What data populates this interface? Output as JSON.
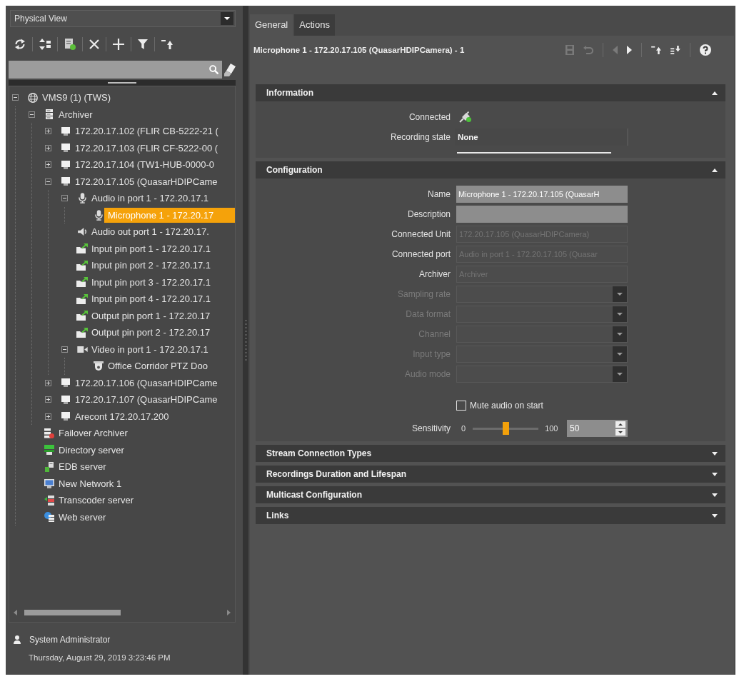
{
  "left_panel": {
    "view": "Physical View",
    "toolbar": [
      [
        {
          "kind": "refresh"
        }
      ],
      [
        {
          "kind": "sort"
        }
      ],
      [
        {
          "kind": "add-entity"
        }
      ],
      [
        {
          "kind": "delete"
        }
      ],
      [
        {
          "kind": "add"
        }
      ],
      [
        {
          "kind": "filter"
        }
      ],
      [
        {
          "kind": "move-up"
        }
      ]
    ],
    "tree": [
      {
        "label": "VMS9 (1) (TWS)",
        "kind": "system",
        "expanded": true,
        "selected": false,
        "children": [
          {
            "label": "Archiver",
            "kind": "archiver",
            "expanded": true,
            "selected": false,
            "children": [
              {
                "label": "172.20.17.102 (FLIR CB-5222-21 (",
                "kind": "unit",
                "expanded": false,
                "selected": false
              },
              {
                "label": "172.20.17.103 (FLIR CF-5222-00 (",
                "kind": "unit",
                "expanded": false,
                "selected": false
              },
              {
                "label": "172.20.17.104 (TW1-HUB-0000-0",
                "kind": "unit",
                "expanded": false,
                "selected": false
              },
              {
                "label": "172.20.17.105 (QuasarHDIPCame",
                "kind": "unit",
                "expanded": true,
                "selected": false,
                "children": [
                  {
                    "label": "Audio in port 1 - 172.20.17.1",
                    "kind": "audio-in",
                    "expanded": true,
                    "selected": false,
                    "children": [
                      {
                        "label": "Microphone 1 - 172.20.17",
                        "kind": "microphone",
                        "selected": true
                      }
                    ]
                  },
                  {
                    "label": "Audio out port 1 - 172.20.17.",
                    "kind": "audio-out",
                    "selected": false
                  },
                  {
                    "label": "Input pin port 1 - 172.20.17.1",
                    "kind": "input-pin",
                    "selected": false
                  },
                  {
                    "label": "Input pin port 2 - 172.20.17.1",
                    "kind": "input-pin",
                    "selected": false
                  },
                  {
                    "label": "Input pin port 3 - 172.20.17.1",
                    "kind": "input-pin",
                    "selected": false
                  },
                  {
                    "label": "Input pin port 4 - 172.20.17.1",
                    "kind": "input-pin",
                    "selected": false
                  },
                  {
                    "label": "Output pin port 1 - 172.20.17",
                    "kind": "output-pin",
                    "selected": false
                  },
                  {
                    "label": "Output pin port 2 - 172.20.17",
                    "kind": "output-pin",
                    "selected": false
                  },
                  {
                    "label": "Video in port 1 - 172.20.17.1",
                    "kind": "video-in",
                    "expanded": true,
                    "selected": false,
                    "children": [
                      {
                        "label": "Office Corridor PTZ Doo",
                        "kind": "camera",
                        "selected": false
                      }
                    ]
                  }
                ]
              },
              {
                "label": "172.20.17.106 (QuasarHDIPCame",
                "kind": "unit",
                "expanded": false,
                "selected": false
              },
              {
                "label": "172.20.17.107 (QuasarHDIPCame",
                "kind": "unit",
                "expanded": false,
                "selected": false
              },
              {
                "label": "Arecont 172.20.17.200",
                "kind": "unit",
                "expanded": false,
                "selected": false
              }
            ]
          },
          {
            "label": "Failover Archiver",
            "kind": "failover-archiver",
            "selected": false
          },
          {
            "label": "Directory server",
            "kind": "directory",
            "selected": false
          },
          {
            "label": "EDB server",
            "kind": "database",
            "selected": false
          },
          {
            "label": "New Network 1",
            "kind": "network",
            "selected": false
          },
          {
            "label": "Transcoder server",
            "kind": "transcoder",
            "selected": false
          },
          {
            "label": "Web server",
            "kind": "web-server",
            "selected": false
          }
        ]
      }
    ],
    "user": "System Administrator",
    "datetime": "Thursday, August 29, 2019 3:23:46 PM"
  },
  "right_panel": {
    "tabs": [
      {
        "label": "General",
        "selected": true
      },
      {
        "label": "Actions",
        "selected": false
      }
    ],
    "title": "Microphone 1 - 172.20.17.105 (QuasarHDIPCamera) - 1",
    "toolbar": [
      [
        {
          "kind": "save",
          "disabled": true
        },
        {
          "kind": "undo",
          "disabled": true
        }
      ],
      [
        {
          "kind": "previous",
          "disabled": true
        },
        {
          "kind": "next",
          "disabled": false
        }
      ],
      [
        {
          "kind": "move-up",
          "disabled": false
        },
        {
          "kind": "move-down",
          "disabled": false
        }
      ],
      [
        {
          "kind": "help",
          "disabled": false
        }
      ]
    ],
    "sections": [
      {
        "title": "Information",
        "expanded": true,
        "rows": [
          {
            "kind": "status",
            "label": "Connected",
            "connected": true
          },
          {
            "kind": "value",
            "label": "Recording state",
            "value": "None"
          }
        ]
      },
      {
        "title": "Configuration",
        "expanded": true,
        "rows": [
          {
            "kind": "text",
            "label": "Name",
            "value": "Microphone 1 - 172.20.17.105 (QuasarH",
            "read_only": false,
            "disabled": false
          },
          {
            "kind": "text",
            "label": "Description",
            "read_only": false,
            "disabled": false
          },
          {
            "kind": "text",
            "label": "Connected Unit",
            "value": "172.20.17.105 (QuasarHDIPCamera)",
            "read_only": true,
            "disabled": false
          },
          {
            "kind": "text",
            "label": "Connected port",
            "value": "Audio in port 1 - 172.20.17.105 (Quasar",
            "read_only": true,
            "disabled": false
          },
          {
            "kind": "text",
            "label": "Archiver",
            "value": "Archiver",
            "read_only": true,
            "disabled": false
          },
          {
            "kind": "dropdown",
            "label": "Sampling rate",
            "disabled": true
          },
          {
            "kind": "dropdown",
            "label": "Data format",
            "disabled": true
          },
          {
            "kind": "dropdown",
            "label": "Channel",
            "disabled": true
          },
          {
            "kind": "dropdown",
            "label": "Input type",
            "disabled": true
          },
          {
            "kind": "dropdown",
            "label": "Audio mode",
            "disabled": true
          },
          {
            "kind": "checkbox",
            "label": "Mute audio on start",
            "checked": false
          },
          {
            "kind": "slider",
            "label": "Sensitivity",
            "min_label": "0",
            "max_label": "100",
            "level": 0.5,
            "value": "50"
          }
        ]
      },
      {
        "title": "Stream Connection Types",
        "expanded": false
      },
      {
        "title": "Recordings Duration and Lifespan",
        "expanded": false
      },
      {
        "title": "Multicast Configuration",
        "expanded": false
      },
      {
        "title": "Links",
        "expanded": false
      }
    ]
  }
}
